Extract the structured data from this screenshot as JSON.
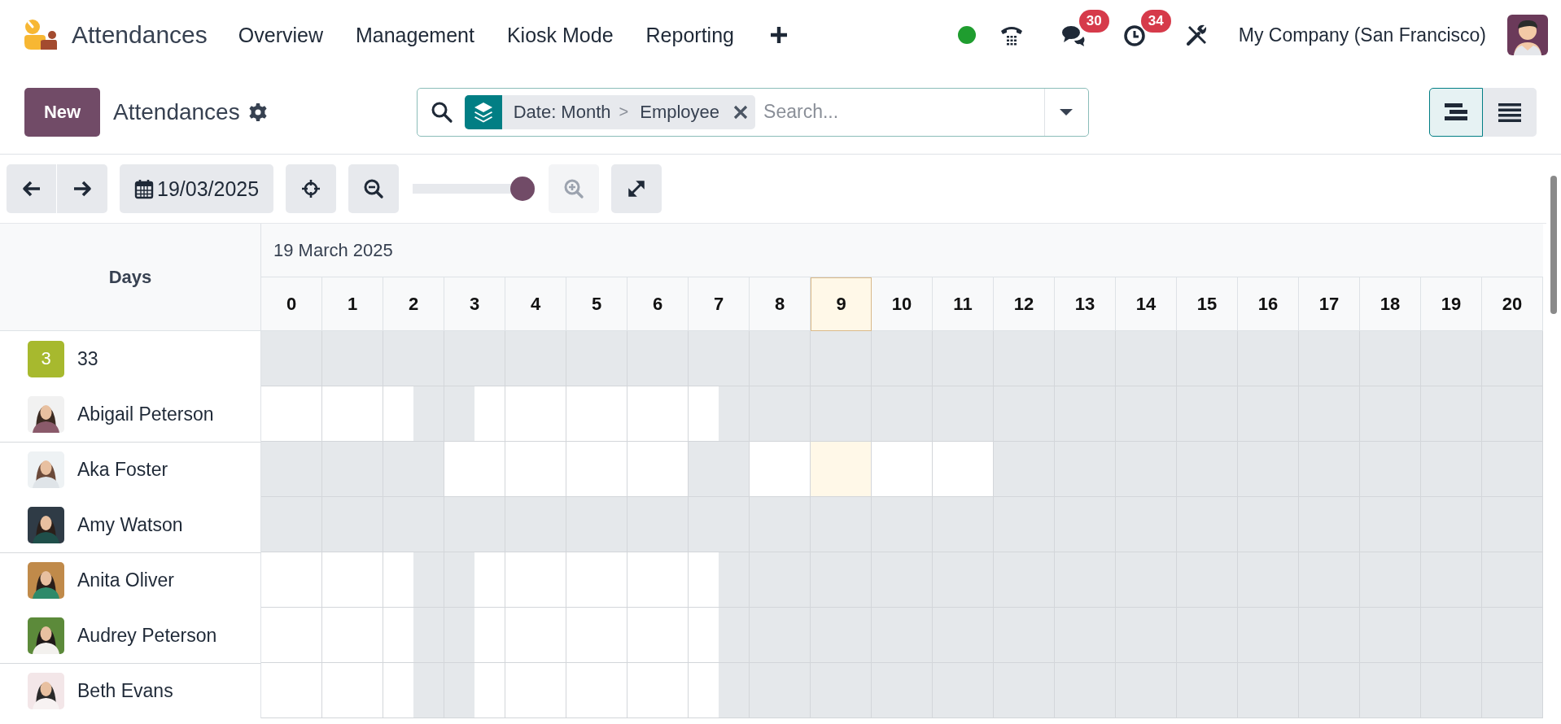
{
  "navbar": {
    "app_name": "Attendances",
    "menu": [
      "Overview",
      "Management",
      "Kiosk Mode",
      "Reporting"
    ],
    "messages_count": "30",
    "activities_count": "34",
    "company": "My Company (San Francisco)"
  },
  "control_panel": {
    "new_button": "New",
    "title": "Attendances",
    "facet": {
      "group_by": [
        "Date: Month",
        "Employee"
      ],
      "separator": ">"
    },
    "search": {
      "placeholder": "Search..."
    },
    "views": [
      {
        "kind": "gantt",
        "selected": true
      },
      {
        "kind": "list",
        "selected": false
      }
    ]
  },
  "toolbar": {
    "date": "19/03/2025",
    "zoom": {
      "level": 1
    },
    "zoom_in": {
      "disabled": true
    }
  },
  "gantt": {
    "row_header": "Days",
    "period": "19 March 2025",
    "hours": [
      {
        "label": "0",
        "current": false
      },
      {
        "label": "1",
        "current": false
      },
      {
        "label": "2",
        "current": false
      },
      {
        "label": "3",
        "current": false
      },
      {
        "label": "4",
        "current": false
      },
      {
        "label": "5",
        "current": false
      },
      {
        "label": "6",
        "current": false
      },
      {
        "label": "7",
        "current": false
      },
      {
        "label": "8",
        "current": false
      },
      {
        "label": "9",
        "current": true
      },
      {
        "label": "10",
        "current": false
      },
      {
        "label": "11",
        "current": false
      },
      {
        "label": "12",
        "current": false
      },
      {
        "label": "13",
        "current": false
      },
      {
        "label": "14",
        "current": false
      },
      {
        "label": "15",
        "current": false
      },
      {
        "label": "16",
        "current": false
      },
      {
        "label": "17",
        "current": false
      },
      {
        "label": "18",
        "current": false
      },
      {
        "label": "19",
        "current": false
      },
      {
        "label": "20",
        "current": false
      }
    ],
    "rows": [
      {
        "name": "33",
        "avatar": {
          "kind": "initial",
          "text": "3"
        },
        "separator_above": false,
        "cells": [
          {
            "first_open": false,
            "second_open": false
          },
          {
            "first_open": false,
            "second_open": false
          },
          {
            "first_open": false,
            "second_open": false
          },
          {
            "first_open": false,
            "second_open": false
          },
          {
            "first_open": false,
            "second_open": false
          },
          {
            "first_open": false,
            "second_open": false
          },
          {
            "first_open": false,
            "second_open": false
          },
          {
            "first_open": false,
            "second_open": false
          },
          {
            "first_open": false,
            "second_open": false
          },
          {
            "first_open": false,
            "second_open": false
          },
          {
            "first_open": false,
            "second_open": false
          },
          {
            "first_open": false,
            "second_open": false
          },
          {
            "first_open": false,
            "second_open": false
          },
          {
            "first_open": false,
            "second_open": false
          },
          {
            "first_open": false,
            "second_open": false
          },
          {
            "first_open": false,
            "second_open": false
          },
          {
            "first_open": false,
            "second_open": false
          },
          {
            "first_open": false,
            "second_open": false
          },
          {
            "first_open": false,
            "second_open": false
          },
          {
            "first_open": false,
            "second_open": false
          },
          {
            "first_open": false,
            "second_open": false
          }
        ]
      },
      {
        "name": "Abigail Peterson",
        "separator_above": false,
        "cells": [
          {
            "first_open": true,
            "second_open": true
          },
          {
            "first_open": true,
            "second_open": true
          },
          {
            "first_open": true,
            "second_open": false
          },
          {
            "first_open": false,
            "second_open": true
          },
          {
            "first_open": true,
            "second_open": true
          },
          {
            "first_open": true,
            "second_open": true
          },
          {
            "first_open": true,
            "second_open": true
          },
          {
            "first_open": true,
            "second_open": false
          },
          {
            "first_open": false,
            "second_open": false
          },
          {
            "first_open": false,
            "second_open": false
          },
          {
            "first_open": false,
            "second_open": false
          },
          {
            "first_open": false,
            "second_open": false
          },
          {
            "first_open": false,
            "second_open": false
          },
          {
            "first_open": false,
            "second_open": false
          },
          {
            "first_open": false,
            "second_open": false
          },
          {
            "first_open": false,
            "second_open": false
          },
          {
            "first_open": false,
            "second_open": false
          },
          {
            "first_open": false,
            "second_open": false
          },
          {
            "first_open": false,
            "second_open": false
          },
          {
            "first_open": false,
            "second_open": false
          },
          {
            "first_open": false,
            "second_open": false
          }
        ]
      },
      {
        "name": "Aka Foster",
        "separator_above": true,
        "cells": [
          {
            "first_open": false,
            "second_open": false
          },
          {
            "first_open": false,
            "second_open": false
          },
          {
            "first_open": false,
            "second_open": false
          },
          {
            "first_open": true,
            "second_open": true
          },
          {
            "first_open": true,
            "second_open": true
          },
          {
            "first_open": true,
            "second_open": true
          },
          {
            "first_open": true,
            "second_open": true
          },
          {
            "first_open": false,
            "second_open": false
          },
          {
            "first_open": true,
            "second_open": true
          },
          {
            "first_open": true,
            "second_open": true
          },
          {
            "first_open": true,
            "second_open": true
          },
          {
            "first_open": true,
            "second_open": true
          },
          {
            "first_open": false,
            "second_open": false
          },
          {
            "first_open": false,
            "second_open": false
          },
          {
            "first_open": false,
            "second_open": false
          },
          {
            "first_open": false,
            "second_open": false
          },
          {
            "first_open": false,
            "second_open": false
          },
          {
            "first_open": false,
            "second_open": false
          },
          {
            "first_open": false,
            "second_open": false
          },
          {
            "first_open": false,
            "second_open": false
          },
          {
            "first_open": false,
            "second_open": false
          }
        ]
      },
      {
        "name": "Amy Watson",
        "separator_above": false,
        "cells": [
          {
            "first_open": false,
            "second_open": false
          },
          {
            "first_open": false,
            "second_open": false
          },
          {
            "first_open": false,
            "second_open": false
          },
          {
            "first_open": false,
            "second_open": false
          },
          {
            "first_open": false,
            "second_open": false
          },
          {
            "first_open": false,
            "second_open": false
          },
          {
            "first_open": false,
            "second_open": false
          },
          {
            "first_open": false,
            "second_open": false
          },
          {
            "first_open": false,
            "second_open": false
          },
          {
            "first_open": false,
            "second_open": false
          },
          {
            "first_open": false,
            "second_open": false
          },
          {
            "first_open": false,
            "second_open": false
          },
          {
            "first_open": false,
            "second_open": false
          },
          {
            "first_open": false,
            "second_open": false
          },
          {
            "first_open": false,
            "second_open": false
          },
          {
            "first_open": false,
            "second_open": false
          },
          {
            "first_open": false,
            "second_open": false
          },
          {
            "first_open": false,
            "second_open": false
          },
          {
            "first_open": false,
            "second_open": false
          },
          {
            "first_open": false,
            "second_open": false
          },
          {
            "first_open": false,
            "second_open": false
          }
        ]
      },
      {
        "name": "Anita Oliver",
        "separator_above": true,
        "cells": [
          {
            "first_open": true,
            "second_open": true
          },
          {
            "first_open": true,
            "second_open": true
          },
          {
            "first_open": true,
            "second_open": false
          },
          {
            "first_open": false,
            "second_open": true
          },
          {
            "first_open": true,
            "second_open": true
          },
          {
            "first_open": true,
            "second_open": true
          },
          {
            "first_open": true,
            "second_open": true
          },
          {
            "first_open": true,
            "second_open": false
          },
          {
            "first_open": false,
            "second_open": false
          },
          {
            "first_open": false,
            "second_open": false
          },
          {
            "first_open": false,
            "second_open": false
          },
          {
            "first_open": false,
            "second_open": false
          },
          {
            "first_open": false,
            "second_open": false
          },
          {
            "first_open": false,
            "second_open": false
          },
          {
            "first_open": false,
            "second_open": false
          },
          {
            "first_open": false,
            "second_open": false
          },
          {
            "first_open": false,
            "second_open": false
          },
          {
            "first_open": false,
            "second_open": false
          },
          {
            "first_open": false,
            "second_open": false
          },
          {
            "first_open": false,
            "second_open": false
          },
          {
            "first_open": false,
            "second_open": false
          }
        ]
      },
      {
        "name": "Audrey Peterson",
        "separator_above": false,
        "cells": [
          {
            "first_open": true,
            "second_open": true
          },
          {
            "first_open": true,
            "second_open": true
          },
          {
            "first_open": true,
            "second_open": false
          },
          {
            "first_open": false,
            "second_open": true
          },
          {
            "first_open": true,
            "second_open": true
          },
          {
            "first_open": true,
            "second_open": true
          },
          {
            "first_open": true,
            "second_open": true
          },
          {
            "first_open": true,
            "second_open": false
          },
          {
            "first_open": false,
            "second_open": false
          },
          {
            "first_open": false,
            "second_open": false
          },
          {
            "first_open": false,
            "second_open": false
          },
          {
            "first_open": false,
            "second_open": false
          },
          {
            "first_open": false,
            "second_open": false
          },
          {
            "first_open": false,
            "second_open": false
          },
          {
            "first_open": false,
            "second_open": false
          },
          {
            "first_open": false,
            "second_open": false
          },
          {
            "first_open": false,
            "second_open": false
          },
          {
            "first_open": false,
            "second_open": false
          },
          {
            "first_open": false,
            "second_open": false
          },
          {
            "first_open": false,
            "second_open": false
          },
          {
            "first_open": false,
            "second_open": false
          }
        ]
      },
      {
        "name": "Beth Evans",
        "separator_above": true,
        "cells": [
          {
            "first_open": true,
            "second_open": true
          },
          {
            "first_open": true,
            "second_open": true
          },
          {
            "first_open": true,
            "second_open": false
          },
          {
            "first_open": false,
            "second_open": true
          },
          {
            "first_open": true,
            "second_open": true
          },
          {
            "first_open": true,
            "second_open": true
          },
          {
            "first_open": true,
            "second_open": true
          },
          {
            "first_open": true,
            "second_open": false
          },
          {
            "first_open": false,
            "second_open": false
          },
          {
            "first_open": false,
            "second_open": false
          },
          {
            "first_open": false,
            "second_open": false
          },
          {
            "first_open": false,
            "second_open": false
          },
          {
            "first_open": false,
            "second_open": false
          },
          {
            "first_open": false,
            "second_open": false
          },
          {
            "first_open": false,
            "second_open": false
          },
          {
            "first_open": false,
            "second_open": false
          },
          {
            "first_open": false,
            "second_open": false
          },
          {
            "first_open": false,
            "second_open": false
          },
          {
            "first_open": false,
            "second_open": false
          },
          {
            "first_open": false,
            "second_open": false
          },
          {
            "first_open": false,
            "second_open": false
          }
        ]
      }
    ]
  }
}
